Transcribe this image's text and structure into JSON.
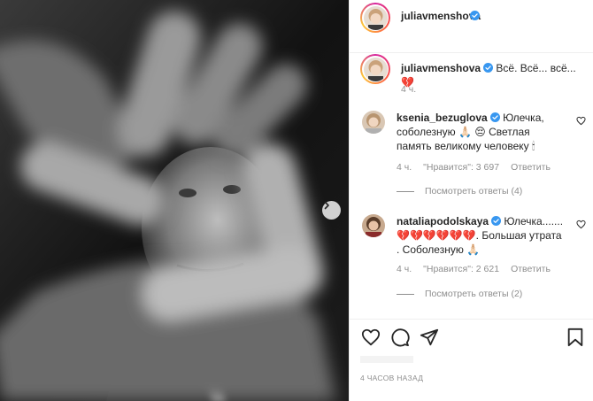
{
  "post": {
    "author": "juliavmenshova",
    "caption_author": "juliavmenshova",
    "caption": "Всё. Всё... всё... 💔",
    "caption_time": "4 ч.",
    "posted_ago": "4 ЧАСОВ НАЗАД"
  },
  "comments": [
    {
      "author": "ksenia_bezuglova",
      "text": "Юлечка, соболезную 🙏🏻 😔 Светлая память великому человеку 🕯",
      "time": "4 ч.",
      "likes": "\"Нравится\": 3 697",
      "reply": "Ответить",
      "view_replies": "Посмотреть ответы (4)"
    },
    {
      "author": "nataliapodolskaya",
      "text": "Юлечка....... 💔💔💔💔💔💔. Большая утрата . Соболезную 🙏🏻",
      "time": "4 ч.",
      "likes": "\"Нравится\": 2 621",
      "reply": "Ответить",
      "view_replies": "Посмотреть ответы (2)"
    }
  ],
  "icons": {
    "verified": "verified-badge-icon",
    "like": "heart-icon",
    "comment": "comment-icon",
    "share": "paper-plane-icon",
    "save": "bookmark-icon",
    "next": "chevron-right-icon"
  },
  "colors": {
    "verified": "#3897f0",
    "muted": "#8e8e8e",
    "text": "#262626"
  }
}
